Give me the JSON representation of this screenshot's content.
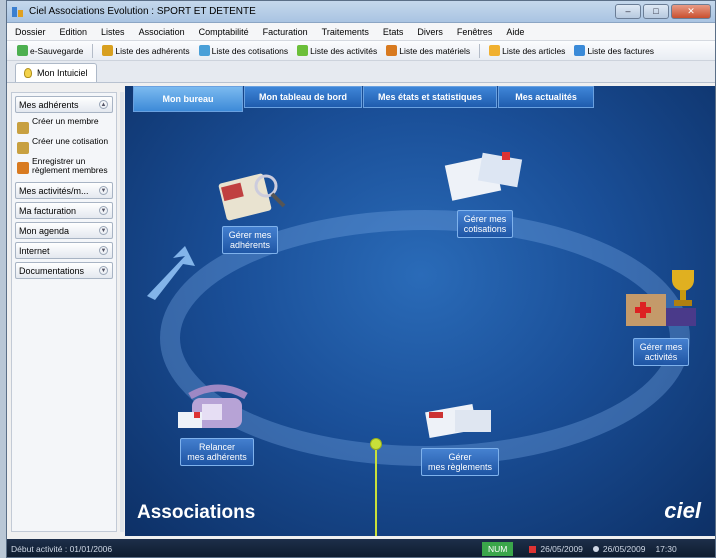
{
  "window": {
    "title": "Ciel Associations Evolution : SPORT ET DETENTE",
    "buttons": [
      "–",
      "□",
      "✕"
    ]
  },
  "menu": [
    "Dossier",
    "Edition",
    "Listes",
    "Association",
    "Comptabilité",
    "Facturation",
    "Traitements",
    "Etats",
    "Divers",
    "Fenêtres",
    "Aide"
  ],
  "toolbar": [
    {
      "label": "e-Sauvegarde",
      "icon": "save-icon",
      "color": "#4caf50"
    },
    {
      "label": "Liste des adhérents",
      "icon": "members-list-icon",
      "color": "#d8a020"
    },
    {
      "label": "Liste des cotisations",
      "icon": "contributions-list-icon",
      "color": "#4aa0d8"
    },
    {
      "label": "Liste des activités",
      "icon": "activities-list-icon",
      "color": "#6bbf3a"
    },
    {
      "label": "Liste des matériels",
      "icon": "materials-list-icon",
      "color": "#d87a20"
    },
    {
      "label": "Liste des articles",
      "icon": "articles-list-icon",
      "color": "#f0b030"
    },
    {
      "label": "Liste des factures",
      "icon": "invoices-list-icon",
      "color": "#3a8ad8"
    }
  ],
  "tab": {
    "label": "Mon Intuiciel"
  },
  "sidebar": {
    "sections": [
      {
        "label": "Mes adhérents",
        "expanded": true,
        "links": [
          {
            "label": "Créer un membre"
          },
          {
            "label": "Créer une cotisation"
          },
          {
            "label": "Enregistrer un règlement membres"
          }
        ]
      },
      {
        "label": "Mes activités/m...",
        "expanded": false
      },
      {
        "label": "Ma facturation",
        "expanded": false
      },
      {
        "label": "Mon agenda",
        "expanded": false
      },
      {
        "label": "Internet",
        "expanded": false
      },
      {
        "label": "Documentations",
        "expanded": false
      }
    ]
  },
  "desk": {
    "tabs": [
      "Mon bureau",
      "Mon tableau de bord",
      "Mes états et statistiques",
      "Mes actualités"
    ],
    "tiles": {
      "adherents": "Gérer mes\nadhérents",
      "cotisations": "Gérer mes\ncotisations",
      "activites": "Gérer mes\nactivités",
      "reglements": "Gérer\nmes règlements",
      "relancer": "Relancer\nmes adhérents"
    },
    "brand_left": "Associations",
    "brand_right": "ciel"
  },
  "status": {
    "start": "Début activité : 01/01/2006",
    "num": "NUM",
    "date1": "26/05/2009",
    "date2": "26/05/2009",
    "time": "17:30"
  }
}
